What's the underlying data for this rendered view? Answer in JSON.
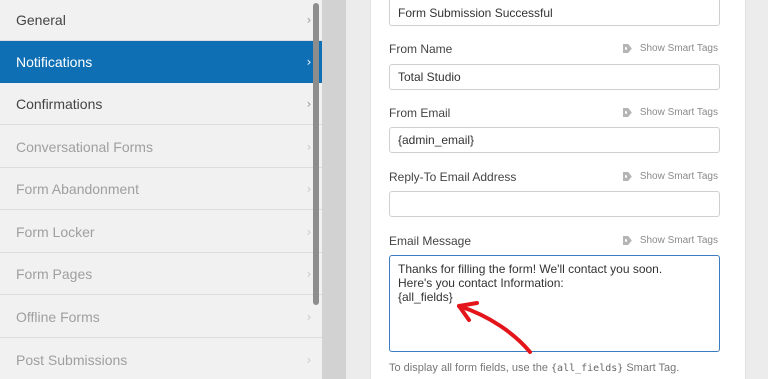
{
  "sidebar": {
    "items": [
      {
        "label": "General",
        "state": "normal"
      },
      {
        "label": "Notifications",
        "state": "active"
      },
      {
        "label": "Confirmations",
        "state": "normal"
      },
      {
        "label": "Conversational Forms",
        "state": "disabled"
      },
      {
        "label": "Form Abandonment",
        "state": "disabled"
      },
      {
        "label": "Form Locker",
        "state": "disabled"
      },
      {
        "label": "Form Pages",
        "state": "disabled"
      },
      {
        "label": "Offline Forms",
        "state": "disabled"
      },
      {
        "label": "Post Submissions",
        "state": "disabled"
      }
    ],
    "chevron": "›"
  },
  "form": {
    "subject_value": "Form Submission Successful",
    "smart_tags_label": "Show Smart Tags",
    "from_name": {
      "label": "From Name",
      "value": "Total Studio"
    },
    "from_email": {
      "label": "From Email",
      "value": "{admin_email}"
    },
    "reply_to": {
      "label": "Reply-To Email Address",
      "value": ""
    },
    "email_message": {
      "label": "Email Message",
      "lines": [
        "Thanks for filling the form! We'll contact you soon.",
        "Here's you contact Information:",
        "{all_fields}"
      ]
    },
    "help": {
      "prefix": "To display all form fields, use the ",
      "code": "{all_fields}",
      "suffix": " Smart Tag."
    }
  },
  "colors": {
    "active_nav": "#0e6fb5",
    "annotation_arrow": "#e3151a",
    "textarea_focus": "#3b7bbf"
  },
  "icons": {
    "smart_tag": "tag-icon",
    "nav_chevron": "chevron-right-icon"
  }
}
